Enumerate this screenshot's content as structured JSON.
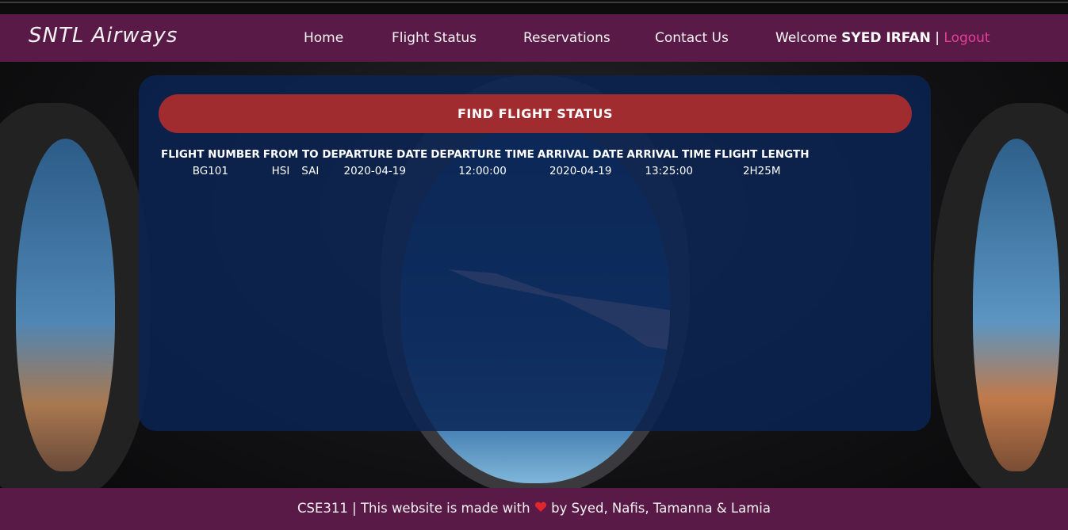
{
  "brand": "SNTL Airways",
  "nav": {
    "home": "Home",
    "flight_status": "Flight Status",
    "reservations": "Reservations",
    "contact": "Contact Us"
  },
  "user": {
    "welcome": "Welcome",
    "name": "SYED IRFAN",
    "separator": "|",
    "logout": "Logout"
  },
  "panel": {
    "button": "FIND FLIGHT STATUS",
    "columns": [
      "FLIGHT NUMBER",
      "FROM",
      "TO",
      "DEPARTURE DATE",
      "DEPARTURE TIME",
      "ARRIVAL DATE",
      "ARRIVAL TIME",
      "FLIGHT LENGTH"
    ],
    "rows": [
      [
        "BG101",
        "HSI",
        "SAI",
        "2020-04-19",
        "12:00:00",
        "2020-04-19",
        "13:25:00",
        "2H25M"
      ]
    ]
  },
  "footer": {
    "prefix": "CSE311 | This website is made with",
    "heart_icon": "heart-icon",
    "suffix": "by Syed, Nafis, Tamanna & Lamia"
  },
  "colors": {
    "header_bg": "#5a1a47",
    "button_bg": "#a02c2f",
    "panel_bg": "#0a2454",
    "logout": "#e63f98"
  }
}
